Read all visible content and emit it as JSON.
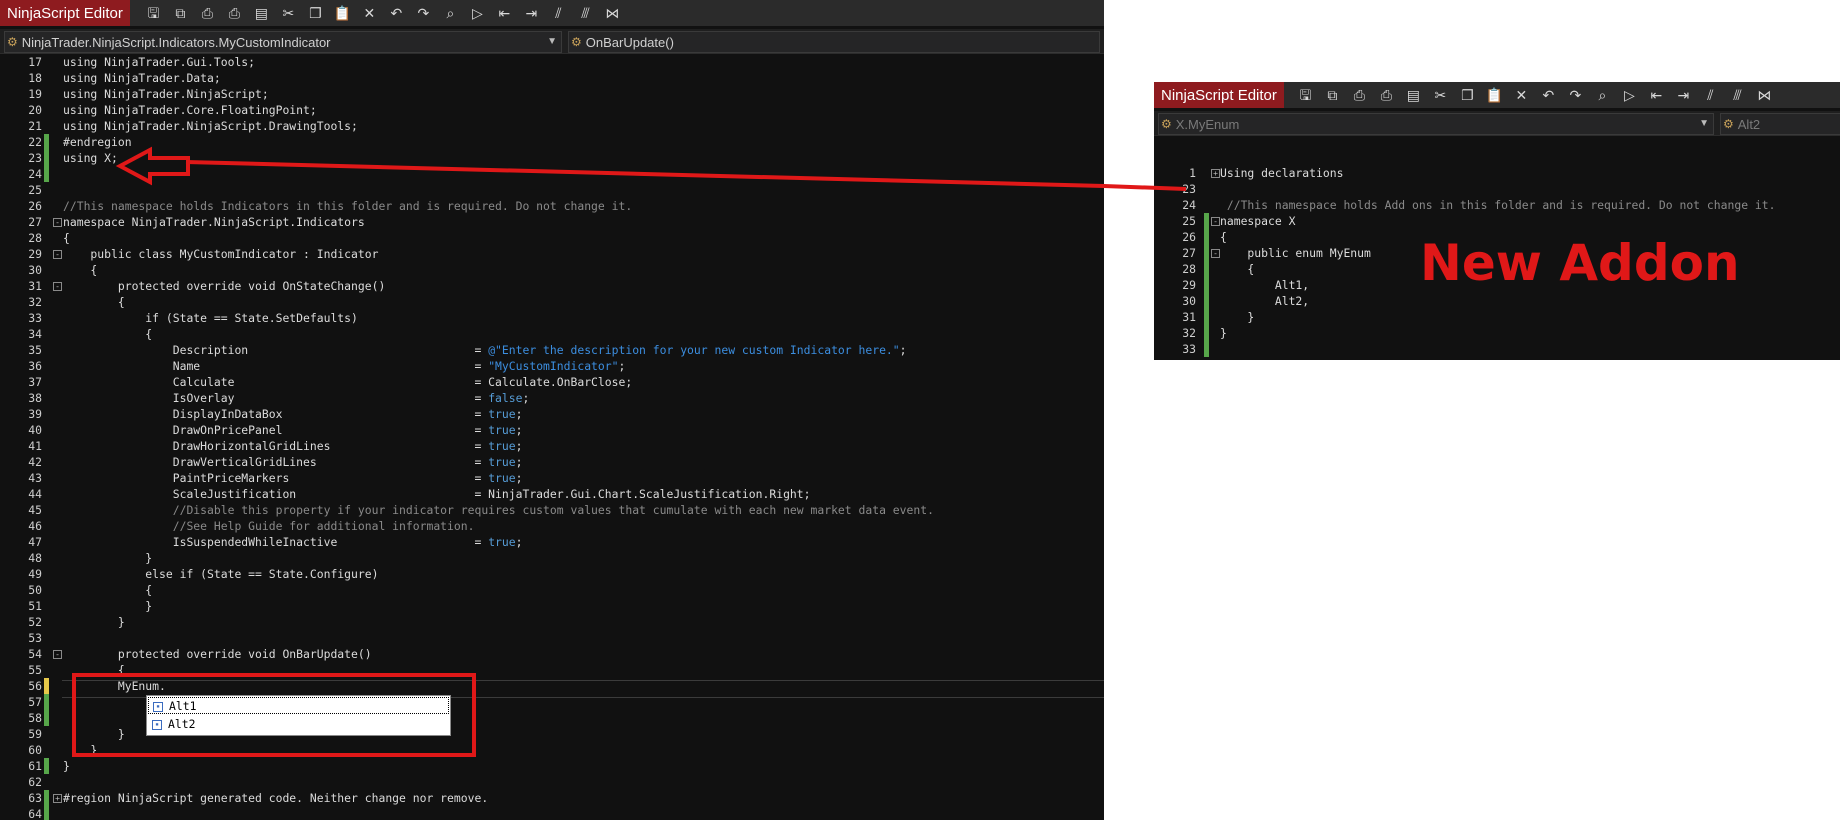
{
  "main_editor": {
    "title": "NinjaScript Editor",
    "nav_left": "NinjaTrader.NinjaScript.Indicators.MyCustomIndicator",
    "nav_right": "OnBarUpdate()",
    "toolbar_icons": [
      "save-icon",
      "save-all-icon",
      "print-icon",
      "print-preview-icon",
      "compile-icon",
      "cut-icon",
      "copy-icon",
      "paste-icon",
      "delete-icon",
      "undo-icon",
      "redo-icon",
      "find-icon",
      "command-icon",
      "outdent-icon",
      "indent-icon",
      "comment-icon",
      "uncomment-icon",
      "visual-studio-icon"
    ],
    "lines": [
      {
        "n": "17",
        "g": "",
        "f": "",
        "t": [
          [
            "using NinjaTrader.Gui.Tools;",
            ""
          ]
        ]
      },
      {
        "n": "18",
        "g": "",
        "f": "",
        "t": [
          [
            "using NinjaTrader.Data;",
            ""
          ]
        ]
      },
      {
        "n": "19",
        "g": "",
        "f": "",
        "t": [
          [
            "using NinjaTrader.NinjaScript;",
            ""
          ]
        ]
      },
      {
        "n": "20",
        "g": "",
        "f": "",
        "t": [
          [
            "using NinjaTrader.Core.FloatingPoint;",
            ""
          ]
        ]
      },
      {
        "n": "21",
        "g": "",
        "f": "",
        "t": [
          [
            "using NinjaTrader.NinjaScript.DrawingTools;",
            ""
          ]
        ]
      },
      {
        "n": "22",
        "g": "green",
        "f": "",
        "t": [
          [
            "#endregion",
            ""
          ]
        ]
      },
      {
        "n": "23",
        "g": "green",
        "f": "",
        "t": [
          [
            "using X;",
            ""
          ]
        ]
      },
      {
        "n": "24",
        "g": "green",
        "f": "",
        "t": [
          [
            "",
            ""
          ]
        ]
      },
      {
        "n": "25",
        "g": "",
        "f": "",
        "t": [
          [
            "",
            ""
          ]
        ]
      },
      {
        "n": "26",
        "g": "",
        "f": "",
        "t": [
          [
            "//This namespace holds Indicators in this folder and is required. Do not change it.",
            "c"
          ]
        ]
      },
      {
        "n": "27",
        "g": "",
        "f": "-",
        "t": [
          [
            "namespace NinjaTrader.NinjaScript.Indicators",
            ""
          ]
        ]
      },
      {
        "n": "28",
        "g": "",
        "f": "",
        "t": [
          [
            "{",
            ""
          ]
        ]
      },
      {
        "n": "29",
        "g": "",
        "f": "-",
        "t": [
          [
            "    public class MyCustomIndicator : Indicator",
            ""
          ]
        ]
      },
      {
        "n": "30",
        "g": "",
        "f": "",
        "t": [
          [
            "    {",
            ""
          ]
        ]
      },
      {
        "n": "31",
        "g": "",
        "f": "-",
        "t": [
          [
            "        protected override void OnStateChange()",
            ""
          ]
        ]
      },
      {
        "n": "32",
        "g": "",
        "f": "",
        "t": [
          [
            "        {",
            ""
          ]
        ]
      },
      {
        "n": "33",
        "g": "",
        "f": "",
        "t": [
          [
            "            if (State == State.SetDefaults)",
            ""
          ]
        ]
      },
      {
        "n": "34",
        "g": "",
        "f": "",
        "t": [
          [
            "            {",
            ""
          ]
        ]
      },
      {
        "n": "35",
        "g": "",
        "f": "",
        "t": [
          [
            "                Description                                 = ",
            ""
          ],
          [
            "@\"Enter the description for your new custom Indicator here.\"",
            "s"
          ],
          [
            ";",
            ""
          ]
        ]
      },
      {
        "n": "36",
        "g": "",
        "f": "",
        "t": [
          [
            "                Name                                        = ",
            ""
          ],
          [
            "\"MyCustomIndicator\"",
            "s"
          ],
          [
            ";",
            ""
          ]
        ]
      },
      {
        "n": "37",
        "g": "",
        "f": "",
        "t": [
          [
            "                Calculate                                   = Calculate.OnBarClose;",
            ""
          ]
        ]
      },
      {
        "n": "38",
        "g": "",
        "f": "",
        "t": [
          [
            "                IsOverlay                                   = ",
            ""
          ],
          [
            "false",
            "k"
          ],
          [
            ";",
            ""
          ]
        ]
      },
      {
        "n": "39",
        "g": "",
        "f": "",
        "t": [
          [
            "                DisplayInDataBox                            = ",
            ""
          ],
          [
            "true",
            "k"
          ],
          [
            ";",
            ""
          ]
        ]
      },
      {
        "n": "40",
        "g": "",
        "f": "",
        "t": [
          [
            "                DrawOnPricePanel                            = ",
            ""
          ],
          [
            "true",
            "k"
          ],
          [
            ";",
            ""
          ]
        ]
      },
      {
        "n": "41",
        "g": "",
        "f": "",
        "t": [
          [
            "                DrawHorizontalGridLines                     = ",
            ""
          ],
          [
            "true",
            "k"
          ],
          [
            ";",
            ""
          ]
        ]
      },
      {
        "n": "42",
        "g": "",
        "f": "",
        "t": [
          [
            "                DrawVerticalGridLines                       = ",
            ""
          ],
          [
            "true",
            "k"
          ],
          [
            ";",
            ""
          ]
        ]
      },
      {
        "n": "43",
        "g": "",
        "f": "",
        "t": [
          [
            "                PaintPriceMarkers                           = ",
            ""
          ],
          [
            "true",
            "k"
          ],
          [
            ";",
            ""
          ]
        ]
      },
      {
        "n": "44",
        "g": "",
        "f": "",
        "t": [
          [
            "                ScaleJustification                          = NinjaTrader.Gui.Chart.ScaleJustification.Right;",
            ""
          ]
        ]
      },
      {
        "n": "45",
        "g": "",
        "f": "",
        "t": [
          [
            "                //Disable this property if your indicator requires custom values that cumulate with each new market data event.",
            "c"
          ]
        ]
      },
      {
        "n": "46",
        "g": "",
        "f": "",
        "t": [
          [
            "                //See Help Guide for additional information.",
            "c"
          ]
        ]
      },
      {
        "n": "47",
        "g": "",
        "f": "",
        "t": [
          [
            "                IsSuspendedWhileInactive                    = ",
            ""
          ],
          [
            "true",
            "k"
          ],
          [
            ";",
            ""
          ]
        ]
      },
      {
        "n": "48",
        "g": "",
        "f": "",
        "t": [
          [
            "            }",
            ""
          ]
        ]
      },
      {
        "n": "49",
        "g": "",
        "f": "",
        "t": [
          [
            "            else if (State == State.Configure)",
            ""
          ]
        ]
      },
      {
        "n": "50",
        "g": "",
        "f": "",
        "t": [
          [
            "            {",
            ""
          ]
        ]
      },
      {
        "n": "51",
        "g": "",
        "f": "",
        "t": [
          [
            "            }",
            ""
          ]
        ]
      },
      {
        "n": "52",
        "g": "",
        "f": "",
        "t": [
          [
            "        }",
            ""
          ]
        ]
      },
      {
        "n": "53",
        "g": "",
        "f": "",
        "t": [
          [
            "",
            ""
          ]
        ]
      },
      {
        "n": "54",
        "g": "",
        "f": "-",
        "t": [
          [
            "        protected override void OnBarUpdate()",
            ""
          ]
        ]
      },
      {
        "n": "55",
        "g": "",
        "f": "",
        "t": [
          [
            "        {",
            ""
          ]
        ]
      },
      {
        "n": "56",
        "g": "yellow",
        "f": "",
        "t": [
          [
            "        MyEnum.",
            ""
          ]
        ]
      },
      {
        "n": "57",
        "g": "green",
        "f": "",
        "t": [
          [
            "",
            ""
          ]
        ]
      },
      {
        "n": "58",
        "g": "green",
        "f": "",
        "t": [
          [
            "",
            ""
          ]
        ]
      },
      {
        "n": "59",
        "g": "",
        "f": "",
        "t": [
          [
            "        }",
            ""
          ]
        ]
      },
      {
        "n": "60",
        "g": "",
        "f": "",
        "t": [
          [
            "    }",
            ""
          ]
        ]
      },
      {
        "n": "61",
        "g": "green",
        "f": "",
        "t": [
          [
            "}",
            ""
          ]
        ]
      },
      {
        "n": "62",
        "g": "",
        "f": "",
        "t": [
          [
            "",
            ""
          ]
        ]
      },
      {
        "n": "63",
        "g": "green",
        "f": "+",
        "t": [
          [
            "#region NinjaScript generated code. Neither change nor remove.",
            ""
          ]
        ]
      },
      {
        "n": "64",
        "g": "green",
        "f": "",
        "t": [
          [
            "",
            ""
          ]
        ]
      }
    ],
    "autocomplete": [
      "Alt1",
      "Alt2"
    ]
  },
  "addon_editor": {
    "title": "NinjaScript Editor",
    "nav_left": "X.MyEnum",
    "nav_right": "Alt2",
    "toolbar_icons": [
      "save-icon",
      "save-all-icon",
      "print-icon",
      "print-preview-icon",
      "compile-icon",
      "cut-icon",
      "copy-icon",
      "paste-icon",
      "delete-icon",
      "undo-icon",
      "redo-icon",
      "find-icon",
      "command-icon",
      "outdent-icon",
      "indent-icon",
      "comment-icon",
      "uncomment-icon",
      "visual-studio-icon"
    ],
    "lines": [
      {
        "n": "1",
        "g": "",
        "f": "+",
        "t": [
          [
            "Using declarations",
            ""
          ]
        ]
      },
      {
        "n": "23",
        "g": "",
        "f": "",
        "t": [
          [
            "",
            ""
          ]
        ]
      },
      {
        "n": "24",
        "g": "",
        "f": "",
        "t": [
          [
            " //This namespace holds Add ons in this folder and is required. Do not change it.",
            "c"
          ]
        ]
      },
      {
        "n": "25",
        "g": "green",
        "f": "-",
        "t": [
          [
            "namespace X",
            ""
          ]
        ]
      },
      {
        "n": "26",
        "g": "green",
        "f": "",
        "t": [
          [
            "{",
            ""
          ]
        ]
      },
      {
        "n": "27",
        "g": "green",
        "f": "-",
        "t": [
          [
            "    public enum MyEnum",
            ""
          ]
        ]
      },
      {
        "n": "28",
        "g": "green",
        "f": "",
        "t": [
          [
            "    {",
            ""
          ]
        ]
      },
      {
        "n": "29",
        "g": "green",
        "f": "",
        "t": [
          [
            "        Alt1,",
            ""
          ]
        ]
      },
      {
        "n": "30",
        "g": "green",
        "f": "",
        "t": [
          [
            "        Alt2,",
            ""
          ]
        ]
      },
      {
        "n": "31",
        "g": "green",
        "f": "",
        "t": [
          [
            "    }",
            ""
          ]
        ]
      },
      {
        "n": "32",
        "g": "green",
        "f": "",
        "t": [
          [
            "}",
            ""
          ]
        ]
      },
      {
        "n": "33",
        "g": "green",
        "f": "",
        "t": [
          [
            "",
            ""
          ]
        ]
      }
    ]
  },
  "annotation": {
    "label": "New Addon",
    "color": "#e01818"
  }
}
